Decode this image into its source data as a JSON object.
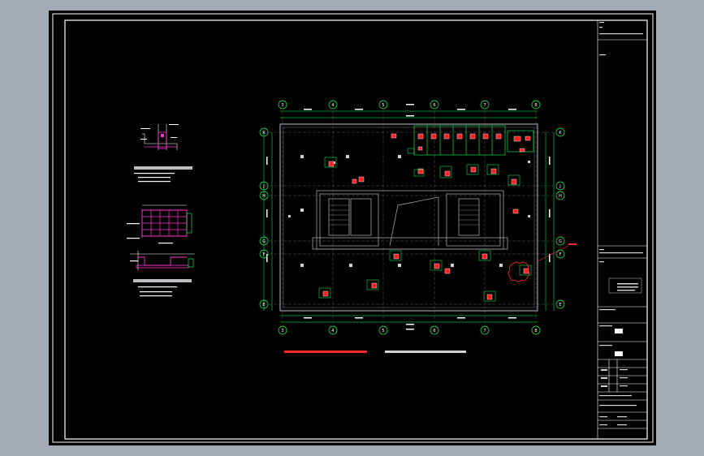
{
  "app": {
    "title": "",
    "background_color": "#a5abb5",
    "canvas_color": "#000000"
  },
  "colors": {
    "frame": "#ffffff",
    "wall": "#9aa0a8",
    "grid_bubble": "#19ff5a",
    "dimension": "#19ff5a",
    "hatch": "#ff1e1e",
    "note_red": "#ff2a2a",
    "detail_magenta": "#ff33cc"
  },
  "plan": {
    "grid_columns": [
      "3",
      "4",
      "5",
      "6",
      "7",
      "8"
    ],
    "grid_rows": [
      "E",
      "F",
      "G",
      "H",
      "J",
      "K"
    ],
    "title_text": "",
    "note_text": ""
  },
  "details": {
    "detail_1_caption": "",
    "detail_2_caption": ""
  },
  "title_block": {
    "rows": [
      "",
      "",
      "",
      "",
      "",
      "",
      "",
      ""
    ]
  }
}
